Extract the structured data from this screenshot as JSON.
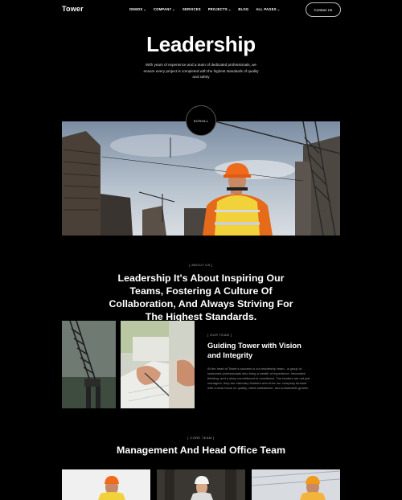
{
  "nav": {
    "logo": "Tower",
    "items": [
      {
        "label": "DEMOS",
        "dropdown": true
      },
      {
        "label": "COMPANY",
        "dropdown": true
      },
      {
        "label": "SERVICES",
        "dropdown": false
      },
      {
        "label": "PROJECTS",
        "dropdown": true
      },
      {
        "label": "BLOG",
        "dropdown": false
      },
      {
        "label": "ALL PAGES",
        "dropdown": true
      }
    ],
    "contact": "Contact Us"
  },
  "hero": {
    "title": "Leadership",
    "subtitle": "With years of experience and a team of dedicated professionals, we ensure every project is completed with the highest standards of quality and safety",
    "scroll": "SCROLL"
  },
  "about": {
    "tag": "[ ABOUT US ]",
    "heading": "Leadership It's About Inspiring Our Teams, Fostering A Culture Of Collaboration, And Always Striving For The Highest Standards."
  },
  "team": {
    "tag": "[ OUR TEAM ]",
    "title": "Guiding Tower with Vision and Integrity",
    "body": "At the heart of Tower's success is our leadership team - a group of seasoned professionals who bring a wealth of experience, innovative thinking, and a deep commitment to excellence. Our leaders are not just managers; they are visionary thinkers who drive our company forward with a clear focus on quality, client satisfaction, and sustainable growth."
  },
  "core": {
    "tag": "[ CORE TEAM ]",
    "heading": "Management And Head Office Team"
  },
  "colors": {
    "background": "#000000",
    "text": "#ffffff",
    "muted": "#9a9a9a",
    "vest": "#f2d23a",
    "helmet": "#ef6a1a"
  }
}
